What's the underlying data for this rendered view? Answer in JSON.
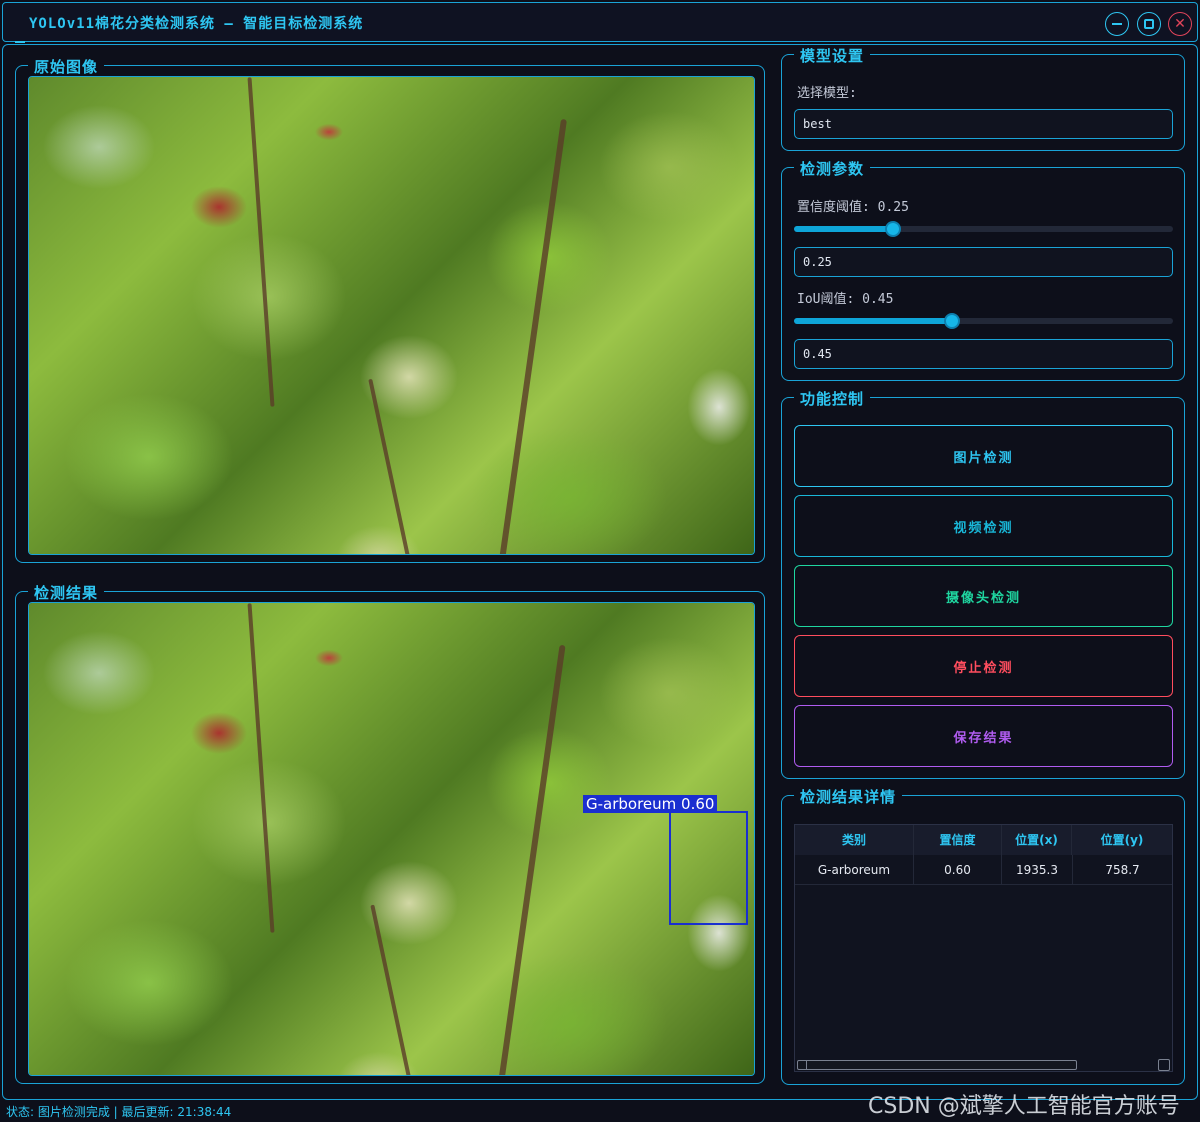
{
  "window": {
    "title": "YOLOv11棉花分类检测系统 – 智能目标检测系统"
  },
  "panels": {
    "original_title": "原始图像",
    "result_title": "检测结果"
  },
  "detection": {
    "label": "G-arboreum  0.60",
    "box_color": "#1a2fd0"
  },
  "model_settings": {
    "title": "模型设置",
    "select_label": "选择模型:",
    "selected_model": "best"
  },
  "params": {
    "title": "检测参数",
    "confidence_label": "置信度阈值: 0.25",
    "confidence_value": "0.25",
    "confidence": 0.25,
    "iou_label": "IoU阈值: 0.45",
    "iou_value": "0.45",
    "iou": 0.45
  },
  "controls": {
    "title": "功能控制",
    "image_detect": "图片检测",
    "video_detect": "视频检测",
    "camera_detect": "摄像头检测",
    "stop_detect": "停止检测",
    "save_results": "保存结果",
    "colors": {
      "image": "#2ec6f2",
      "video": "#19b7d8",
      "camera": "#1fd6a0",
      "stop": "#ff4d5e",
      "save": "#b05cf0"
    }
  },
  "results": {
    "title": "检测结果详情",
    "columns": [
      "类别",
      "置信度",
      "位置(x)",
      "位置(y)"
    ],
    "rows": [
      [
        "G-arboreum",
        "0.60",
        "1935.3",
        "758.7"
      ]
    ]
  },
  "status": {
    "text": "状态: 图片检测完成 | 最后更新: 21:38:44"
  },
  "watermark": "CSDN @斌擎人工智能官方账号"
}
